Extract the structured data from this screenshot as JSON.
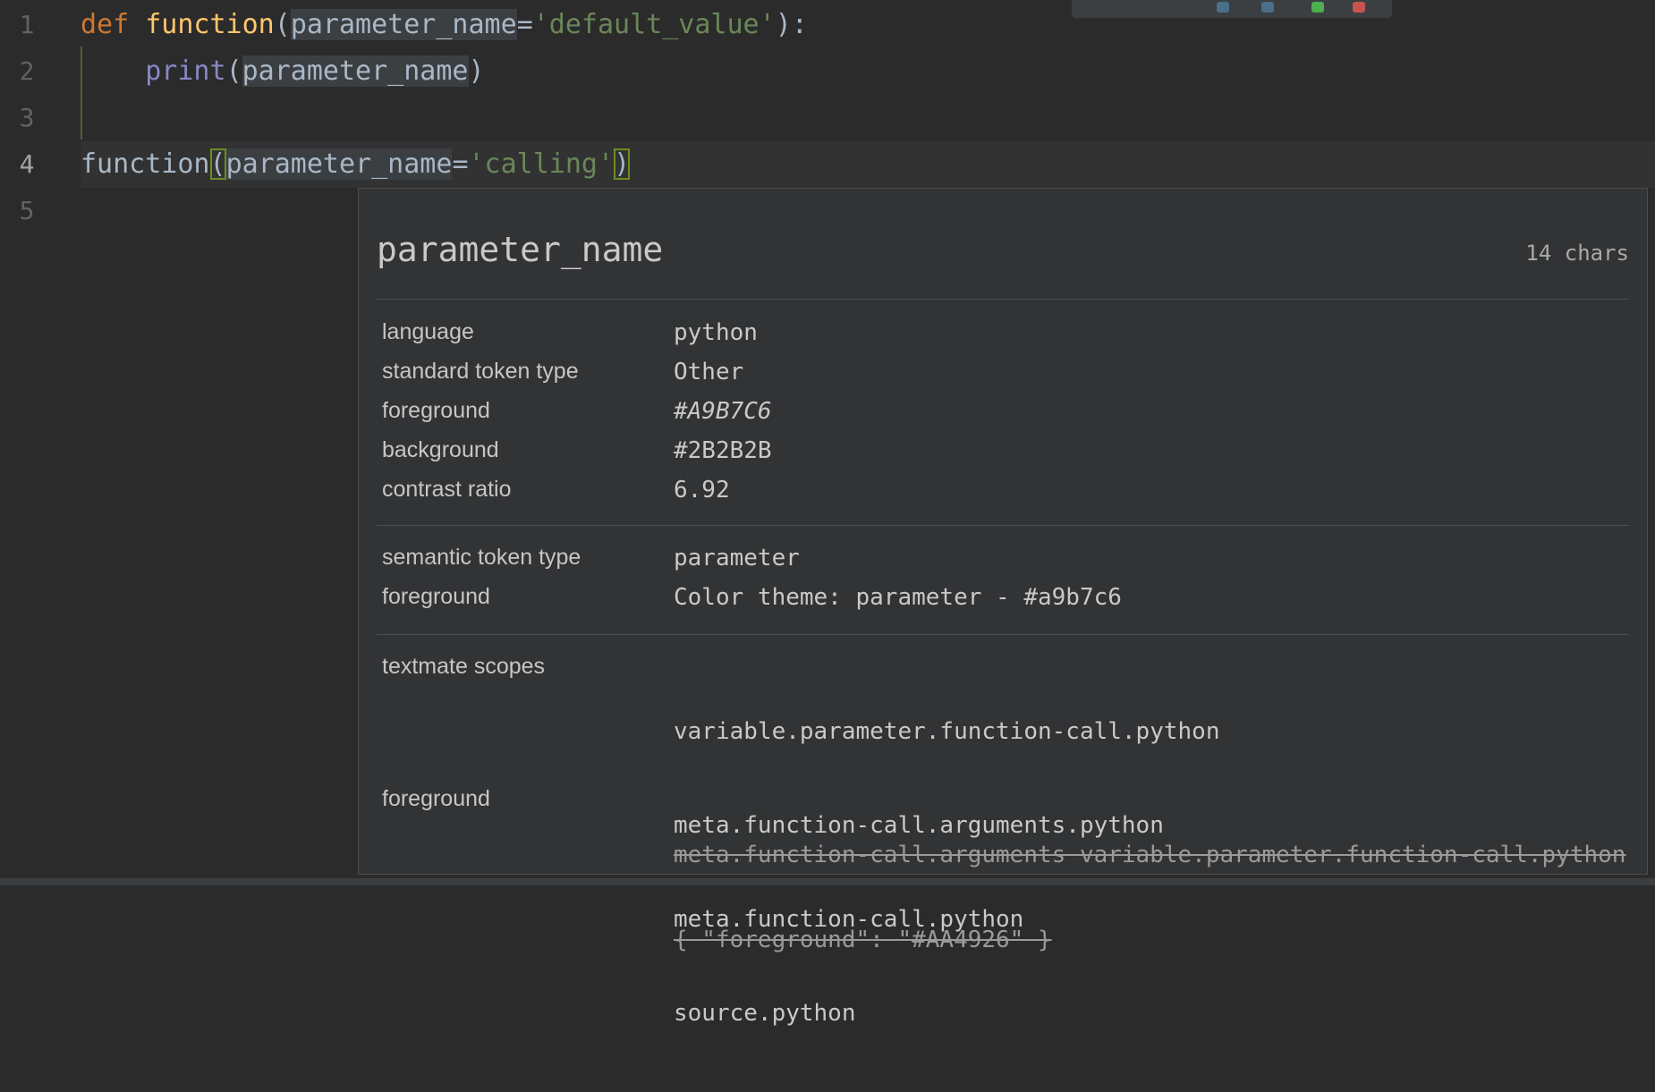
{
  "editor": {
    "line_numbers": [
      "1",
      "2",
      "3",
      "4",
      "5"
    ],
    "line1": {
      "kw": "def",
      "fn": "function",
      "open": "(",
      "param": "parameter_name",
      "eq": "=",
      "str": "'default_value'",
      "close": "):"
    },
    "line2": {
      "builtin": "print",
      "open": "(",
      "param": "parameter_name",
      "close": ")"
    },
    "line4": {
      "fn": "function",
      "open": "(",
      "param": "parameter_name",
      "eq": "=",
      "str": "'calling'",
      "close": ")"
    }
  },
  "inspector": {
    "token": "parameter_name",
    "length": "14 chars",
    "rows": {
      "language_k": "language",
      "language_v": "python",
      "std_type_k": "standard token type",
      "std_type_v": "Other",
      "fg_k": "foreground",
      "fg_v": "#A9B7C6",
      "bg_k": "background",
      "bg_v": "#2B2B2B",
      "contrast_k": "contrast ratio",
      "contrast_v": "6.92",
      "sem_type_k": "semantic token type",
      "sem_type_v": "parameter",
      "sem_fg_k": "foreground",
      "sem_fg_v": "Color theme: parameter - #a9b7c6",
      "scopes_k": "textmate scopes",
      "scopes": [
        "variable.parameter.function-call.python",
        "meta.function-call.arguments.python",
        "meta.function-call.python",
        "source.python"
      ],
      "tm_fg_k": "foreground",
      "tm_fg_rule": "meta.function-call.arguments variable.parameter.function-call.python",
      "tm_fg_value": "{ \"foreground\": \"#AA4926\" }"
    }
  },
  "colors": {
    "background": "#2b2b2b",
    "keyword": "#cc7832",
    "function": "#ffc66d",
    "string": "#6a8759",
    "builtin": "#8888c6",
    "text": "#a9b7c6"
  }
}
